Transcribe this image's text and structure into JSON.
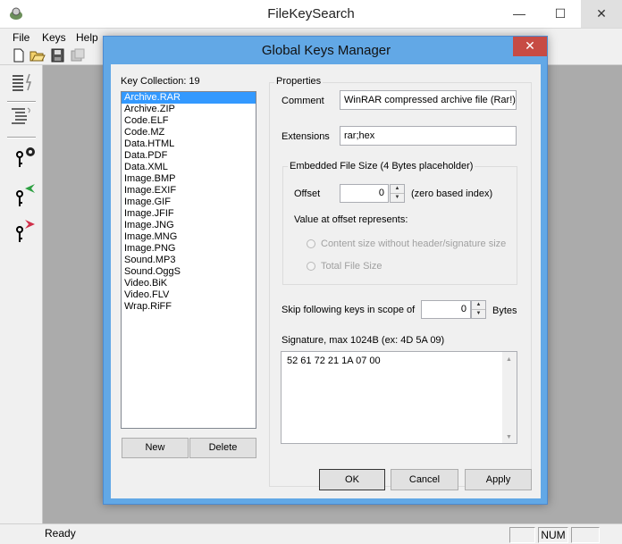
{
  "app": {
    "title": "FileKeySearch",
    "icon": "app-icon",
    "min": "—",
    "max": "☐",
    "close": "✕"
  },
  "menu": [
    "File",
    "Keys",
    "Help"
  ],
  "status": {
    "text": "Ready",
    "panels": [
      "",
      "NUM",
      ""
    ]
  },
  "dialog": {
    "title": "Global Keys Manager",
    "close": "✕",
    "key_collection_label": "Key Collection: 19",
    "keys": [
      "Archive.RAR",
      "Archive.ZIP",
      "Code.ELF",
      "Code.MZ",
      "Data.HTML",
      "Data.PDF",
      "Data.XML",
      "Image.BMP",
      "Image.EXIF",
      "Image.GIF",
      "Image.JFIF",
      "Image.JNG",
      "Image.MNG",
      "Image.PNG",
      "Sound.MP3",
      "Sound.OggS",
      "Video.BiK",
      "Video.FLV",
      "Wrap.RiFF"
    ],
    "selected_index": 0,
    "new_button": "New",
    "delete_button": "Delete",
    "properties_title": "Properties",
    "comment_label": "Comment",
    "comment_value": "WinRAR compressed archive file (Rar!)",
    "extensions_label": "Extensions",
    "extensions_value": "rar;hex",
    "embedded_title": "Embedded File Size (4 Bytes placeholder)",
    "offset_label": "Offset",
    "offset_value": "0",
    "offset_hint": "(zero based index)",
    "represents_label": "Value at offset represents:",
    "radio_content": "Content size without header/signature size",
    "radio_total": "Total File Size",
    "skip_label": "Skip following keys in scope of",
    "skip_value": "0",
    "skip_unit": "Bytes",
    "signature_label": "Signature, max 1024B (ex: 4D 5A 09)",
    "signature_value": "52 61 72 21 1A 07 00",
    "ok_button": "OK",
    "cancel_button": "Cancel",
    "apply_button": "Apply"
  },
  "icons": {
    "toolbar": [
      "new-file-icon",
      "open-folder-icon",
      "save-icon",
      "save-disabled-icon"
    ],
    "sidebar": [
      "list-icon",
      "lightning-icon",
      "indent-list-icon",
      "key-gear-icon",
      "key-green-arrow-icon",
      "key-red-arrow-icon"
    ]
  },
  "colors": {
    "dialog_frame": "#62a8e6",
    "selection": "#3399ff",
    "close_button": "#c74b44",
    "workspace": "#ababab"
  }
}
